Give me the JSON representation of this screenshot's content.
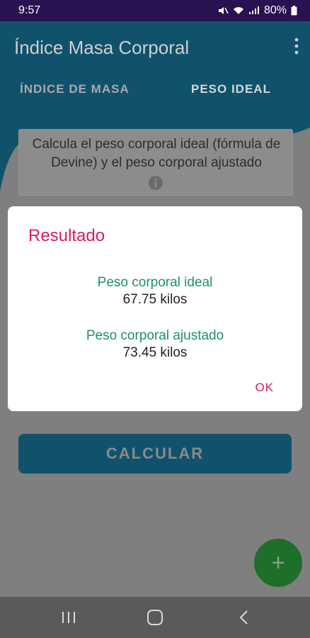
{
  "status_bar": {
    "time": "9:57",
    "battery": "80%"
  },
  "app": {
    "title": "Índice Masa Corporal",
    "tabs": [
      {
        "label": "ÍNDICE DE MASA"
      },
      {
        "label": "PESO IDEAL"
      }
    ],
    "info_text": "Calcula el peso corporal ideal (fórmula de Devine) y el peso corporal ajustado",
    "calculate_label": "CALCULAR",
    "fab_label": "+"
  },
  "dialog": {
    "title": "Resultado",
    "results": [
      {
        "label": "Peso corporal ideal",
        "value": "67.75 kilos"
      },
      {
        "label": "Peso corporal ajustado",
        "value": "73.45 kilos"
      }
    ],
    "ok_label": "OK"
  },
  "colors": {
    "accent": "#d81b60",
    "result_label": "#1f8f6b",
    "primary_dim": "#10526c",
    "fab_dim": "#1d6f2a",
    "status_bar": "#2a1250"
  }
}
